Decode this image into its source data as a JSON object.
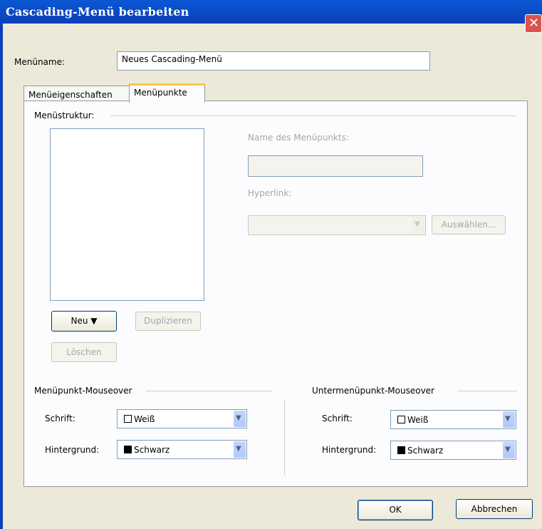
{
  "window": {
    "title": "Cascading-Menü bearbeiten"
  },
  "menu_name": {
    "label": "Menüname:",
    "value": "Neues Cascading-Menü"
  },
  "tabs": [
    {
      "label": "Menüeigenschaften",
      "active": false
    },
    {
      "label": "Menüpunkte",
      "active": true
    }
  ],
  "structure": {
    "label": "Menüstruktur:"
  },
  "item": {
    "name_label": "Name des Menüpunkts:",
    "name_value": "",
    "hyperlink_label": "Hyperlink:",
    "hyperlink_value": "",
    "choose_button": "Auswählen..."
  },
  "buttons": {
    "new": "Neu ▼",
    "duplicate": "Duplizieren",
    "delete": "Löschen",
    "ok": "OK",
    "cancel": "Abbrechen"
  },
  "mouseover": {
    "title": "Menüpunkt-Mouseover",
    "font_label": "Schrift:",
    "font_value": "Weiß",
    "font_color": "#ffffff",
    "bg_label": "Hintergrund:",
    "bg_value": "Schwarz",
    "bg_color": "#000000"
  },
  "submouseover": {
    "title": "Untermenüpunkt-Mouseover",
    "font_label": "Schrift:",
    "font_value": "Weiß",
    "font_color": "#ffffff",
    "bg_label": "Hintergrund:",
    "bg_value": "Schwarz",
    "bg_color": "#000000"
  }
}
